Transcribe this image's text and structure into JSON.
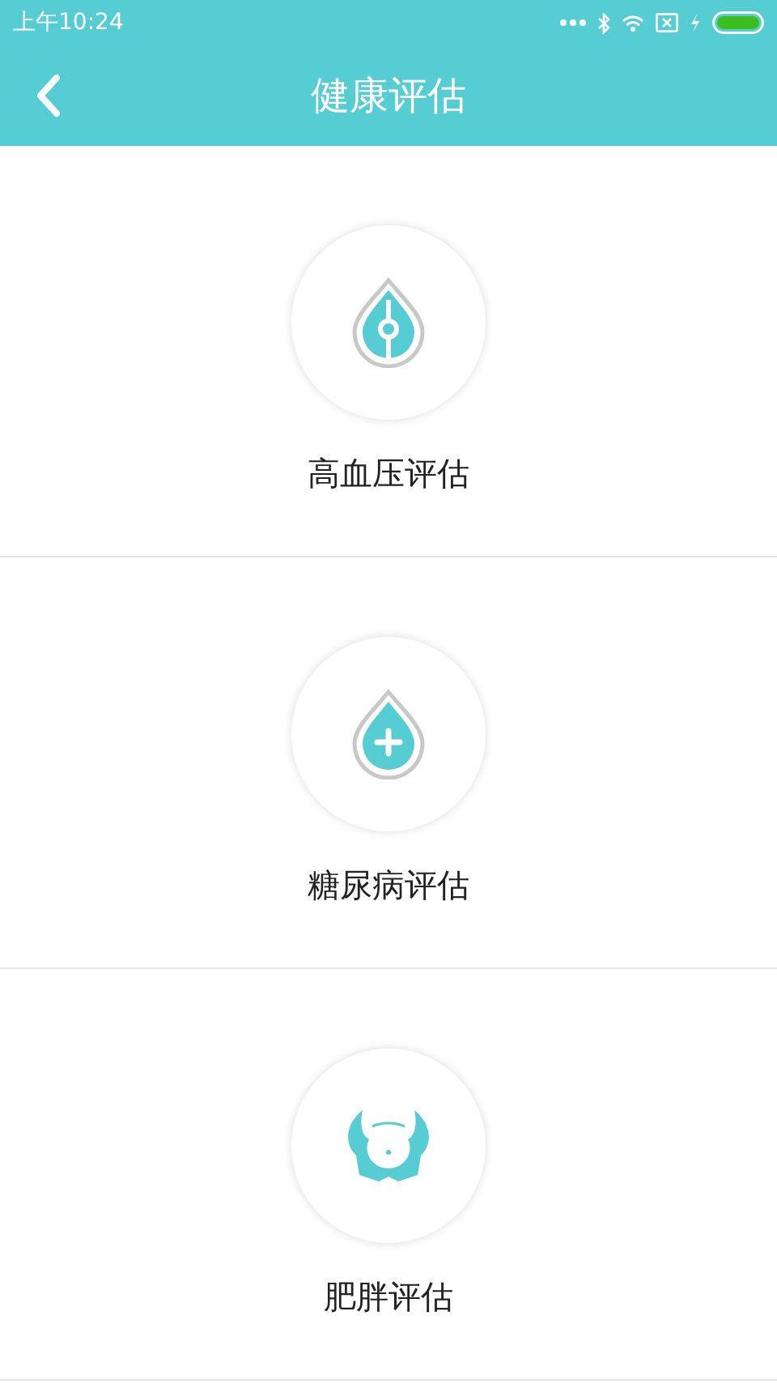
{
  "status_bar": {
    "time": "上午10:24"
  },
  "header": {
    "title": "健康评估"
  },
  "assessments": [
    {
      "kind": "blood-pressure",
      "label": "高血压评估"
    },
    {
      "kind": "diabetes",
      "label": "糖尿病评估"
    },
    {
      "kind": "obesity",
      "label": "肥胖评估"
    }
  ]
}
